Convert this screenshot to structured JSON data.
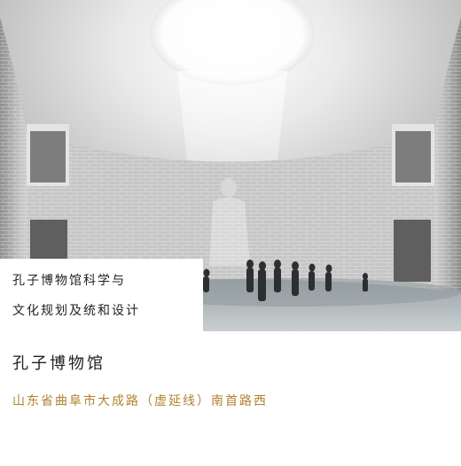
{
  "caption": {
    "line1": "孔子博物馆科学与",
    "line2": "文化规划及统和设计"
  },
  "title": "孔子博物馆",
  "address": "山东省曲阜市大成路（虚延线）南首路西",
  "colors": {
    "address_text": "#b0832e",
    "caption_text": "#222222",
    "background": "#ffffff"
  }
}
